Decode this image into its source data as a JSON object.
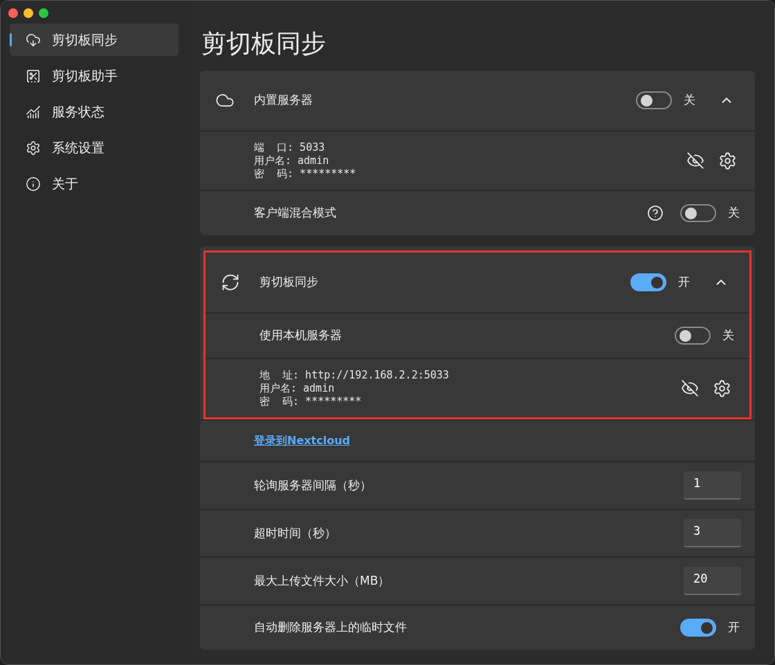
{
  "window": {
    "controls": [
      {
        "kind": "close"
      },
      {
        "kind": "minimize"
      },
      {
        "kind": "zoom"
      }
    ]
  },
  "sidebar": {
    "items": [
      {
        "label": "剪切板同步",
        "selected": true
      },
      {
        "label": "剪切板助手",
        "selected": false
      },
      {
        "label": "服务状态",
        "selected": false
      },
      {
        "label": "系统设置",
        "selected": false
      },
      {
        "label": "关于",
        "selected": false
      }
    ]
  },
  "page_title": "剪切板同步",
  "cards": [
    {
      "sections": [
        {
          "highlighted": false,
          "rows": [
            {
              "kind": "header",
              "label": "内置服务器",
              "on": false,
              "state_text": "关",
              "expanded": true
            },
            {
              "kind": "info",
              "lines": [
                "端  口: 5033",
                "用户名: admin",
                "密  码: *********"
              ]
            },
            {
              "kind": "toggle",
              "label": "客户端混合模式",
              "help": true,
              "on": false,
              "state_text": "关"
            }
          ]
        }
      ]
    },
    {
      "sections": [
        {
          "highlighted": true,
          "rows": [
            {
              "kind": "header",
              "label": "剪切板同步",
              "on": true,
              "state_text": "开",
              "expanded": true
            },
            {
              "kind": "toggle",
              "label": "使用本机服务器",
              "help": false,
              "on": false,
              "state_text": "关"
            },
            {
              "kind": "info",
              "lines": [
                "地  址: http://192.168.2.2:5033",
                "用户名: admin",
                "密  码: *********"
              ]
            }
          ]
        },
        {
          "highlighted": false,
          "rows": [
            {
              "kind": "link",
              "label": "登录到Nextcloud"
            },
            {
              "kind": "number",
              "label": "轮询服务器间隔（秒）",
              "value": "1"
            },
            {
              "kind": "number",
              "label": "超时时间（秒）",
              "value": "3"
            },
            {
              "kind": "number",
              "label": "最大上传文件大小（MB）",
              "value": "20"
            },
            {
              "kind": "toggle",
              "label": "自动删除服务器上的临时文件",
              "help": false,
              "on": true,
              "state_text": "开"
            }
          ]
        }
      ]
    }
  ]
}
